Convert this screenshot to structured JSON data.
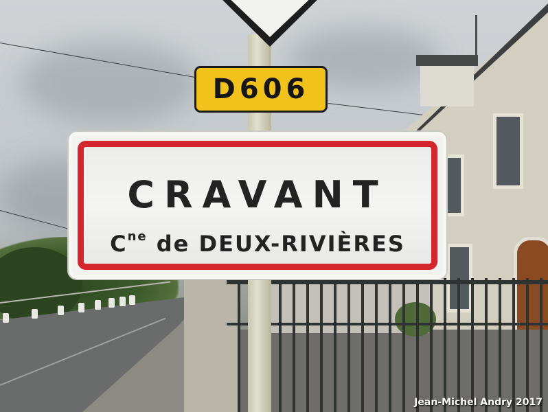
{
  "route_plate": {
    "text": "D606"
  },
  "town_sign": {
    "town": "CRAVANT",
    "commune_abbr": "C",
    "commune_sup": "ne",
    "commune_rest": " de DEUX-RIVIÈRES"
  },
  "credit": "Jean-Michel Andry 2017",
  "colors": {
    "sign_border": "#d6262d",
    "route_plate": "#f2c21c"
  }
}
